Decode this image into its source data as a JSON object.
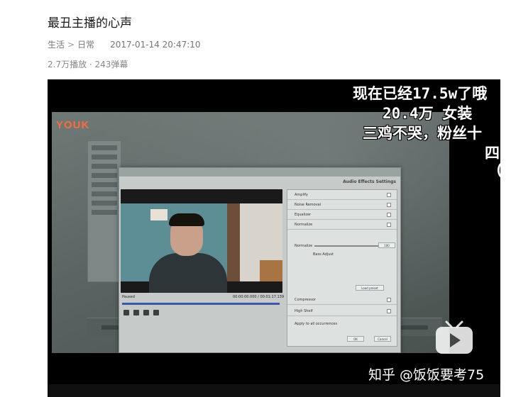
{
  "post": {
    "title": "最丑主播的心声",
    "category": "生活",
    "subcategory": "日常",
    "datetime": "2017-01-14 20:47:10",
    "stats": "2.7万播放 · 243弹幕"
  },
  "video": {
    "danmaku": [
      "现在已经17.5w了哦",
      "20.4万  女装",
      "三鸡不哭，粉丝十",
      "四",
      "("
    ],
    "watermark": "知乎 @饭饭要考75",
    "screen": {
      "logo": "YOUK",
      "dialog_header": "Audio Effects Settings",
      "status": "Paused",
      "timecode": "00:00:00.000 / 00:01:17.139",
      "effects": [
        "Amplify",
        "Noise Removal",
        "Equalizer",
        "Normalize",
        "Compressor",
        "High Shelf"
      ],
      "param_label": "Normalize",
      "param_value": "100",
      "option": "Bass Adjust",
      "apply_all": "Apply to all occurrences",
      "load_preset": "Load preset",
      "ok": "OK",
      "cancel": "Cancel"
    }
  },
  "colors": {
    "player_bg": "#000000",
    "seek_bar": "#3c59a8",
    "logo": "#ff6a3d"
  }
}
